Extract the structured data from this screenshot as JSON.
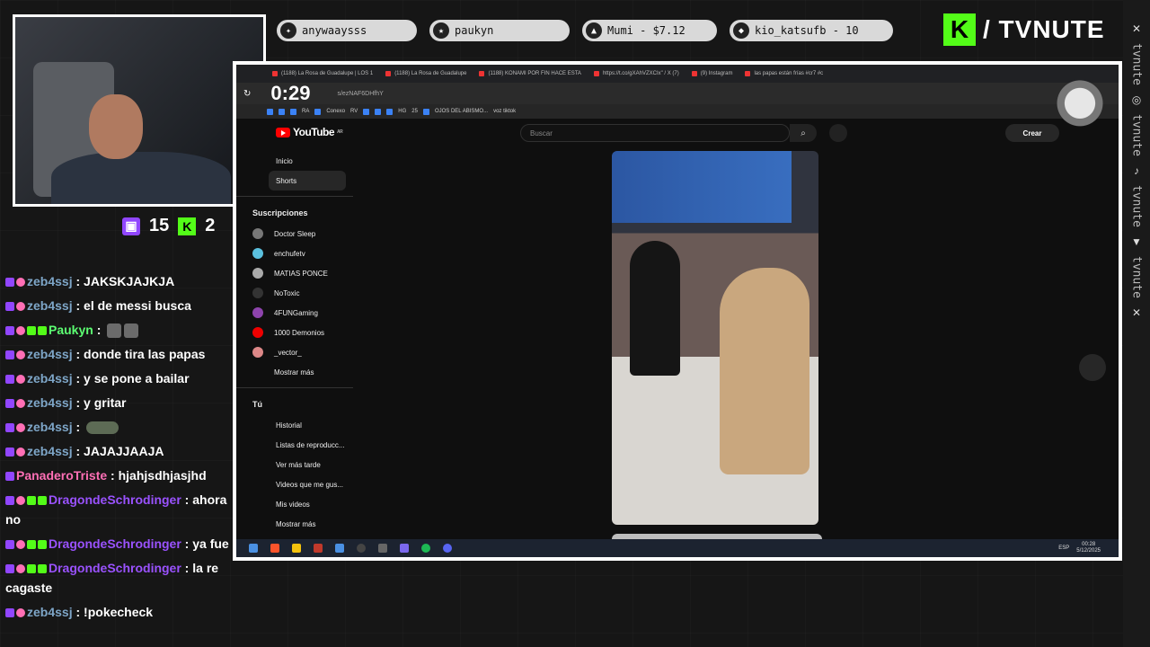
{
  "topbar": {
    "items": [
      {
        "label": "anywaaysss",
        "icon": "sparkle-icon"
      },
      {
        "label": "paukyn",
        "icon": "star-icon"
      },
      {
        "label": "Mumi - $7.12",
        "icon": "drop-icon"
      },
      {
        "label": "kio_katsufb - 10",
        "icon": "shield-icon"
      }
    ],
    "brand": "/ TVNUTE",
    "brand_letter": "K"
  },
  "right_strip": {
    "text": "tvnute"
  },
  "counters": {
    "twitch": "15",
    "kick": "2"
  },
  "chat": [
    {
      "user": "zeb4ssj",
      "text": "JAKSKJAJKJA",
      "color": "blue",
      "badges": [
        "tw",
        "heart"
      ]
    },
    {
      "user": "zeb4ssj",
      "text": "el de messi busca",
      "color": "blue",
      "badges": [
        "tw",
        "heart"
      ]
    },
    {
      "user": "Paukyn",
      "text": "",
      "color": "green",
      "badges": [
        "tw",
        "heart",
        "grn",
        "grn"
      ],
      "emotes": 2
    },
    {
      "user": "zeb4ssj",
      "text": "donde tira las papas",
      "color": "blue",
      "badges": [
        "tw",
        "heart"
      ]
    },
    {
      "user": "zeb4ssj",
      "text": "y se pone a bailar",
      "color": "blue",
      "badges": [
        "tw",
        "heart"
      ]
    },
    {
      "user": "zeb4ssj",
      "text": "y gritar",
      "color": "blue",
      "badges": [
        "tw",
        "heart"
      ]
    },
    {
      "user": "zeb4ssj",
      "text": "",
      "color": "blue",
      "badges": [
        "tw",
        "heart"
      ],
      "wide_emote": true
    },
    {
      "user": "zeb4ssj",
      "text": "JAJAJJAAJA",
      "color": "blue",
      "badges": [
        "tw",
        "heart"
      ]
    },
    {
      "user": "PanaderoTriste",
      "text": "hjahjsdhjasjhd",
      "color": "pink",
      "badges": [
        "tw"
      ]
    },
    {
      "user": "DragondeSchrodinger",
      "text": "ahora no",
      "color": "purple",
      "badges": [
        "tw",
        "heart",
        "grn",
        "grn"
      ]
    },
    {
      "user": "DragondeSchrodinger",
      "text": "ya fue",
      "color": "purple",
      "badges": [
        "tw",
        "heart",
        "grn",
        "grn"
      ]
    },
    {
      "user": "DragondeSchrodinger",
      "text": "la re cagaste",
      "color": "purple",
      "badges": [
        "tw",
        "heart",
        "grn",
        "grn"
      ]
    },
    {
      "user": "zeb4ssj",
      "text": "!pokecheck",
      "color": "blue",
      "badges": [
        "tw",
        "heart"
      ]
    }
  ],
  "browser": {
    "tabs": [
      "(1188) La Rosa de Guadalupe | LOS 1",
      "(1188) La Rosa de Guadalupe",
      "(1188) KONAMI POR FIN HACE ESTA",
      "https://t.co/gXAhVZXCIx\" / X (7)",
      "(9) Instagram",
      "las papas están frías #cr7 #c"
    ],
    "timer": "0:29",
    "url": "s/ezNAF6DHfhY",
    "bookmarks": [
      "RA",
      "Conexo",
      "RV",
      "HG",
      "25",
      "OJOS DEL ABISMO...",
      "voz tiktok"
    ]
  },
  "youtube": {
    "logo": "YouTube",
    "region": "AR",
    "search_placeholder": "Buscar",
    "create": "Crear",
    "nav": [
      "Inicio",
      "Shorts"
    ],
    "subs_title": "Suscripciones",
    "subs": [
      "Doctor Sleep",
      "enchufetv",
      "MATIAS PONCE",
      "NoToxic",
      "4FUNGaming",
      "1000 Demonios",
      "_vector_",
      "Mostrar más"
    ],
    "you_title": "Tú",
    "you": [
      "Historial",
      "Listas de reproducc...",
      "Ver más tarde",
      "Videos que me gus...",
      "Mis videos",
      "Mostrar más"
    ]
  },
  "taskbar": {
    "lang": "ESP",
    "time": "00:28",
    "date": "5/12/2025"
  }
}
